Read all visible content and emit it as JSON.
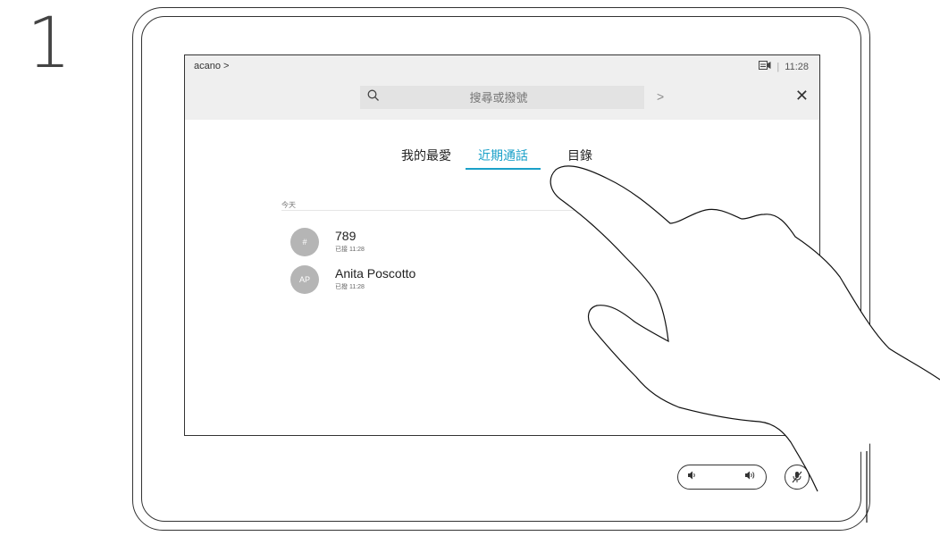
{
  "step": {
    "number": "1"
  },
  "header": {
    "brand": "acano >",
    "time": "11:28",
    "separator": "|",
    "camera_icon": "camera-screen-icon"
  },
  "search": {
    "placeholder": "搜尋或撥號",
    "search_icon": "search-icon",
    "arrow": ">",
    "close": "✕"
  },
  "tabs": [
    {
      "label": "我的最愛",
      "active": false
    },
    {
      "label": "近期通話",
      "active": true
    },
    {
      "label": "目錄",
      "active": false
    }
  ],
  "recents": {
    "section_label": "今天",
    "items": [
      {
        "avatar": "#",
        "title": "789",
        "subtitle": "已接 11:28"
      },
      {
        "avatar": "AP",
        "title": "Anita Poscotto",
        "subtitle": "已撥 11:28"
      }
    ]
  },
  "controls": {
    "volume_down_icon": "speaker-low-icon",
    "volume_up_icon": "speaker-high-icon",
    "mic_icon": "microphone-muted-icon"
  },
  "colors": {
    "accent": "#1aa0c8",
    "avatar": "#b5b5b5",
    "topbar": "#efefef"
  }
}
